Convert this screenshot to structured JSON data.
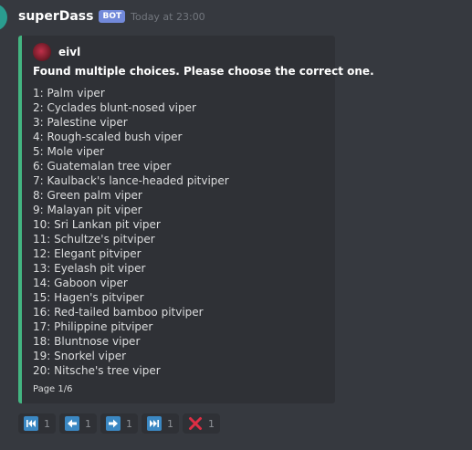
{
  "message": {
    "username": "superDass",
    "badge": "BOT",
    "timestamp": "Today at 23:00"
  },
  "embed": {
    "accent_color": "#43b581",
    "author": "eivl",
    "title": "Found multiple choices. Please choose the correct one.",
    "choices": [
      "1: Palm viper",
      "2: Cyclades blunt-nosed viper",
      "3: Palestine viper",
      "4: Rough-scaled bush viper",
      "5: Mole viper",
      "6: Guatemalan tree viper",
      "7: Kaulback's lance-headed pitviper",
      "8: Green palm viper",
      "9: Malayan pit viper",
      "10: Sri Lankan pit viper",
      "11: Schultze's pitviper",
      "12: Elegant pitviper",
      "13: Eyelash pit viper",
      "14: Gaboon viper",
      "15: Hagen's pitviper",
      "16: Red-tailed bamboo pitviper",
      "17: Philippine pitviper",
      "18: Bluntnose viper",
      "19: Snorkel viper",
      "20: Nitsche's tree viper"
    ],
    "footer": "Page 1/6"
  },
  "reactions": [
    {
      "icon": "first-page-icon",
      "count": "1"
    },
    {
      "icon": "previous-page-icon",
      "count": "1"
    },
    {
      "icon": "next-page-icon",
      "count": "1"
    },
    {
      "icon": "last-page-icon",
      "count": "1"
    },
    {
      "icon": "close-icon",
      "count": "1"
    }
  ],
  "colors": {
    "background": "#36393f",
    "embed_background": "#2f3136",
    "bot_badge": "#7289da",
    "nav_button": "#3b88c3",
    "close": "#dd2e44"
  }
}
